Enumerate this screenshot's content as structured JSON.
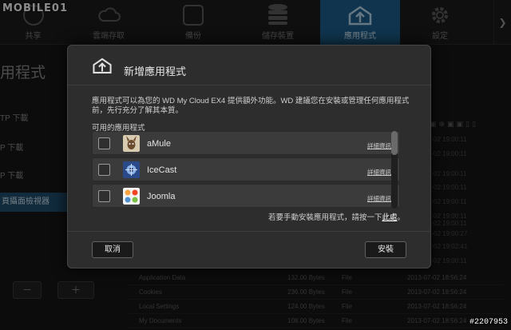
{
  "watermark": {
    "logo_text": "MOBILE01",
    "id_text": "#2207953"
  },
  "nav": {
    "items": [
      {
        "label": "共享",
        "icon": "share-icon"
      },
      {
        "label": "雲端存取",
        "icon": "cloud-icon"
      },
      {
        "label": "備份",
        "icon": "safe-icon"
      },
      {
        "label": "儲存裝置",
        "icon": "database-icon"
      },
      {
        "label": "應用程式",
        "icon": "apps-upload-icon",
        "active": true
      },
      {
        "label": "設定",
        "icon": "gear-icon"
      }
    ],
    "scroll_right": "❯"
  },
  "sidebar": {
    "title": "用程式",
    "items": [
      {
        "label": "TP 下載"
      },
      {
        "label": "P 下載"
      },
      {
        "label": "P 下載"
      },
      {
        "label": "頁攝面檢視器",
        "selected": true
      }
    ],
    "remove_button": "－",
    "add_button": "＋"
  },
  "file_list": [
    {
      "name": "Application Data",
      "size": "132.00 Bytes",
      "type": "File",
      "date": "2013-07-02 18:56:24"
    },
    {
      "name": "Cookies",
      "size": "236.00 Bytes",
      "type": "File",
      "date": "2013-07-02 18:56:24"
    },
    {
      "name": "Local Settings",
      "size": "124.00 Bytes",
      "type": "File",
      "date": "2013-07-02 18:56:24"
    },
    {
      "name": "My Documents",
      "size": "108.00 Bytes",
      "type": "File",
      "date": "2013-07-02 18:56:24"
    }
  ],
  "bg_timestamps": [
    "2013-07-02 19:00:11",
    "2013-07-02 19:00:11",
    "2013-07-02 19:00:11",
    "2013-07-02 19:00:11",
    "2013-07-02 19:00:11",
    "2013-07-02 19:00:11",
    "2013-07-02 19:00:11",
    "2013-07-02 19:00:27",
    "2013-07-02 19:02:41",
    "2013-07-02 19:00:11",
    "2013-07-02 18:56:24"
  ],
  "dialog": {
    "title": "新增應用程式",
    "description": "應用程式可以為您的 WD My Cloud EX4 提供額外功能。WD 建議您在安裝或管理任何應用程式前，先行充分了解其本質。",
    "section_label": "可用的應用程式",
    "apps": [
      {
        "name": "aMule",
        "link": "詳細資訊",
        "logo": "amule-logo"
      },
      {
        "name": "IceCast",
        "link": "詳細資訊",
        "logo": "icecast-logo"
      },
      {
        "name": "Joomla",
        "link": "詳細資訊",
        "logo": "joomla-logo"
      }
    ],
    "manual_prefix": "若要手動安裝應用程式，請按一下",
    "manual_link": "此處",
    "manual_suffix": "。",
    "cancel_label": "取消",
    "install_label": "安裝"
  },
  "colors": {
    "nav_active": "#1e5f8d",
    "dialog_bg": "#2d2d2d",
    "row_bg": "#3b3b3b"
  }
}
